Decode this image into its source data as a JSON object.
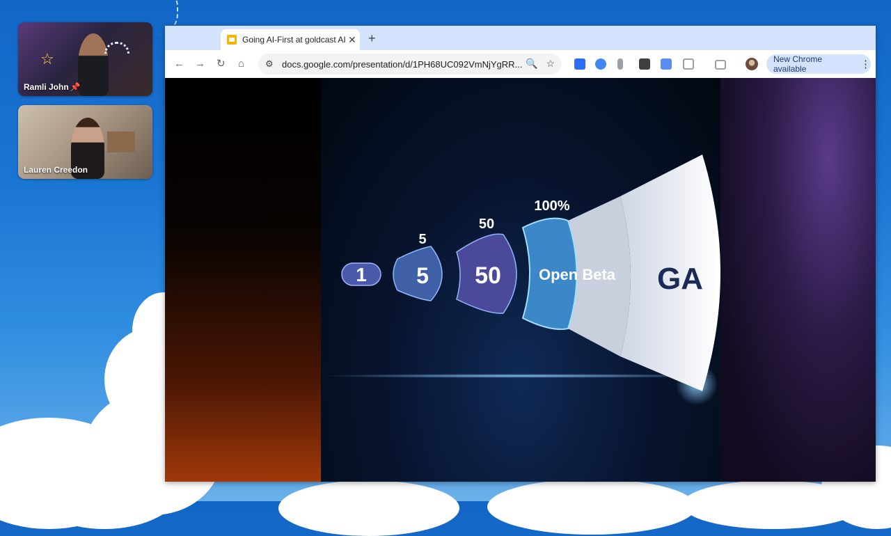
{
  "participants": [
    {
      "name": "Ramli John",
      "pinned": true
    },
    {
      "name": "Lauren Creedon",
      "pinned": false
    }
  ],
  "browser": {
    "tab_title": "Going AI-First at goldcast AI",
    "url": "docs.google.com/presentation/d/1PH68UC092VmNjYgRR...",
    "update_label": "New Chrome available",
    "nav_icons": [
      "back-icon",
      "forward-icon",
      "reload-icon",
      "home-icon"
    ],
    "omnibox_icons": [
      "site-settings-icon",
      "zoom-icon",
      "bookmark-star-icon"
    ]
  },
  "slide": {
    "stages": [
      {
        "top_label": "",
        "inner_label": "1"
      },
      {
        "top_label": "5",
        "inner_label": "5"
      },
      {
        "top_label": "50",
        "inner_label": "50"
      },
      {
        "top_label": "100%",
        "inner_label": "Open Beta"
      },
      {
        "top_label": "",
        "inner_label": "GA"
      }
    ]
  },
  "colors": {
    "accent": "#d3e3fd",
    "stage_1": "#4a5aa8",
    "stage_2": "#3f5fa6",
    "stage_3": "#4b4a9a",
    "stage_4": "#3b87c8",
    "stage_5": "#f4f6fb"
  }
}
